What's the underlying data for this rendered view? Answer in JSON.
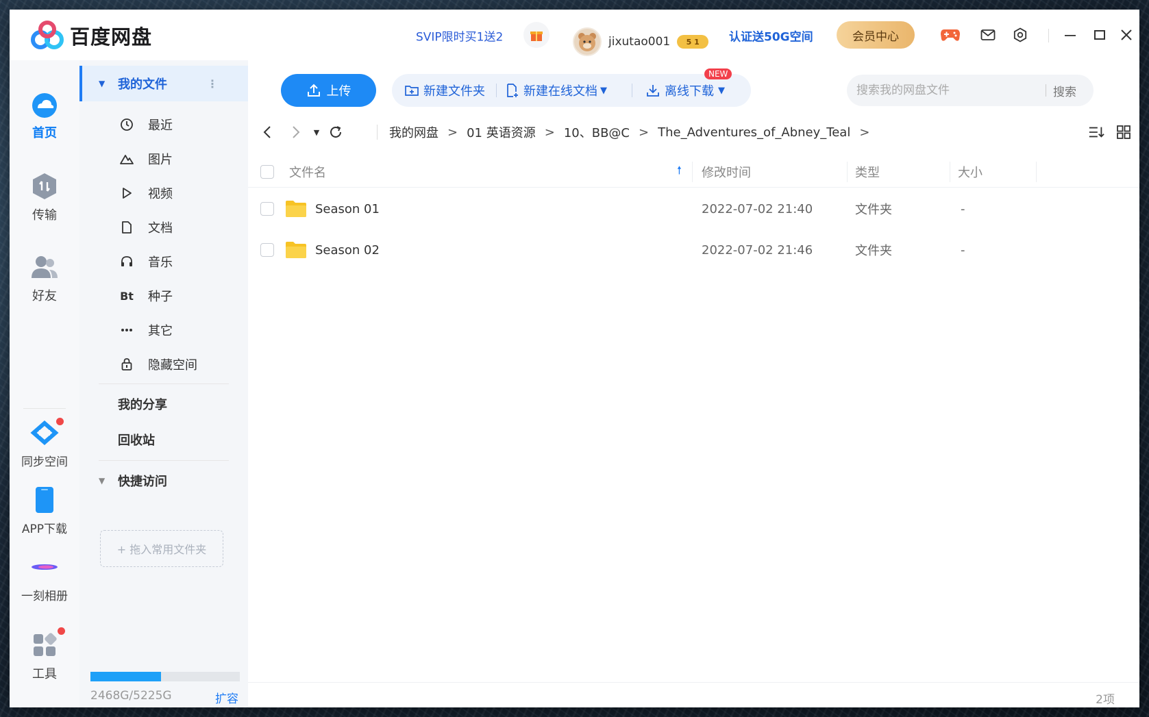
{
  "app": {
    "name": "百度网盘",
    "promo_link": "SVIP限时买1送2",
    "username": "jixutao001",
    "level_badge": "5 1",
    "cert_link": "认证送50G空间",
    "vip_center": "会员中心"
  },
  "rail": {
    "items": [
      {
        "label": "首页"
      },
      {
        "label": "传输"
      },
      {
        "label": "好友"
      },
      {
        "label": "同步空间"
      },
      {
        "label": "APP下载"
      },
      {
        "label": "一刻相册"
      },
      {
        "label": "工具"
      }
    ]
  },
  "nav": {
    "my_files": "我的文件",
    "items": [
      {
        "label": "最近"
      },
      {
        "label": "图片"
      },
      {
        "label": "视频"
      },
      {
        "label": "文档"
      },
      {
        "label": "音乐"
      },
      {
        "label": "种子",
        "icon_text": "Bt"
      },
      {
        "label": "其它"
      },
      {
        "label": "隐藏空间"
      }
    ],
    "my_share": "我的分享",
    "recycle": "回收站",
    "quick_access": "快捷访问",
    "drop_hint": "+ 拖入常用文件夹",
    "quota_text": "2468G/5225G",
    "quota_used_fraction": 0.472,
    "expand": "扩容"
  },
  "toolbar": {
    "upload": "上传",
    "new_folder": "新建文件夹",
    "new_doc": "新建在线文档",
    "new_badge": "NEW",
    "offline_download": "离线下载",
    "search_placeholder": "搜索我的网盘文件",
    "search_button": "搜索"
  },
  "breadcrumb": {
    "items": [
      "我的网盘",
      "01 英语资源",
      "10、BB@C",
      "The_Adventures_of_Abney_Teal"
    ]
  },
  "table": {
    "headers": {
      "name": "文件名",
      "modified": "修改时间",
      "type": "类型",
      "size": "大小"
    },
    "rows": [
      {
        "name": "Season 01",
        "modified": "2022-07-02 21:40",
        "type": "文件夹",
        "size": "-"
      },
      {
        "name": "Season 02",
        "modified": "2022-07-02 21:46",
        "type": "文件夹",
        "size": "-"
      }
    ]
  },
  "status": {
    "count": "2项"
  },
  "colors": {
    "accent": "#1e8af5",
    "link": "#1f63d8",
    "folder": "#f7c325",
    "alert": "#f04848"
  }
}
